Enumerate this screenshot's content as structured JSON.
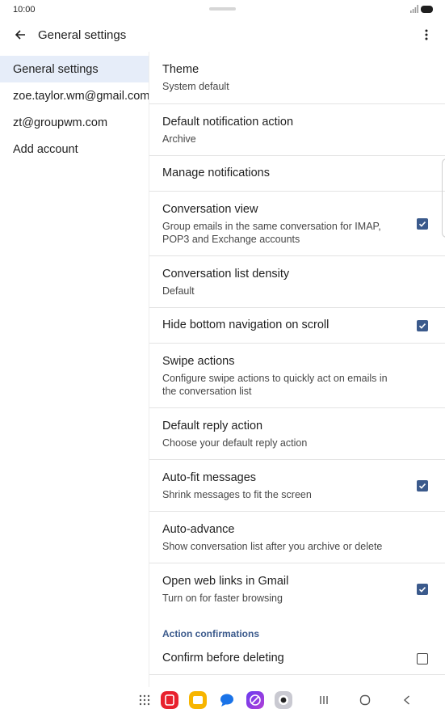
{
  "status_bar": {
    "time": "10:00",
    "signal_icon": "signal-icon",
    "battery_icon": "battery-icon"
  },
  "app_bar": {
    "title": "General settings",
    "back_icon": "back-arrow-icon",
    "more_icon": "more-vert-icon"
  },
  "sidebar": {
    "items": [
      {
        "label": "General settings",
        "active": true
      },
      {
        "label": "zoe.taylor.wm@gmail.com",
        "active": false
      },
      {
        "label": "zt@groupwm.com",
        "active": false
      },
      {
        "label": "Add account",
        "active": false
      }
    ]
  },
  "settings": {
    "theme": {
      "title": "Theme",
      "subtitle": "System default"
    },
    "default_notification_action": {
      "title": "Default notification action",
      "subtitle": "Archive"
    },
    "manage_notifications": {
      "title": "Manage notifications"
    },
    "conversation_view": {
      "title": "Conversation view",
      "subtitle": "Group emails in the same conversation for IMAP, POP3 and Exchange accounts",
      "checked": true
    },
    "conversation_list_density": {
      "title": "Conversation list density",
      "subtitle": "Default"
    },
    "hide_bottom_navigation": {
      "title": "Hide bottom navigation on scroll",
      "checked": true
    },
    "swipe_actions": {
      "title": "Swipe actions",
      "subtitle": "Configure swipe actions to quickly act on emails in the conversation list"
    },
    "default_reply_action": {
      "title": "Default reply action",
      "subtitle": "Choose your default reply action"
    },
    "auto_fit_messages": {
      "title": "Auto-fit messages",
      "subtitle": "Shrink messages to fit the screen",
      "checked": true
    },
    "auto_advance": {
      "title": "Auto-advance",
      "subtitle": "Show conversation list after you archive or delete"
    },
    "open_web_links": {
      "title": "Open web links in Gmail",
      "subtitle": "Turn on for faster browsing",
      "checked": true
    },
    "action_confirmations_header": "Action confirmations",
    "confirm_before_deleting": {
      "title": "Confirm before deleting",
      "checked": false
    }
  },
  "nav_bar": {
    "items": [
      "apps-grid-icon",
      "email-app-icon",
      "notes-app-icon",
      "messages-app-icon",
      "browser-app-icon",
      "camera-app-icon",
      "recents-icon",
      "home-icon",
      "back-icon"
    ]
  },
  "colors": {
    "accent": "#3b5a8c",
    "active_sidebar_bg": "#e6edf9"
  }
}
